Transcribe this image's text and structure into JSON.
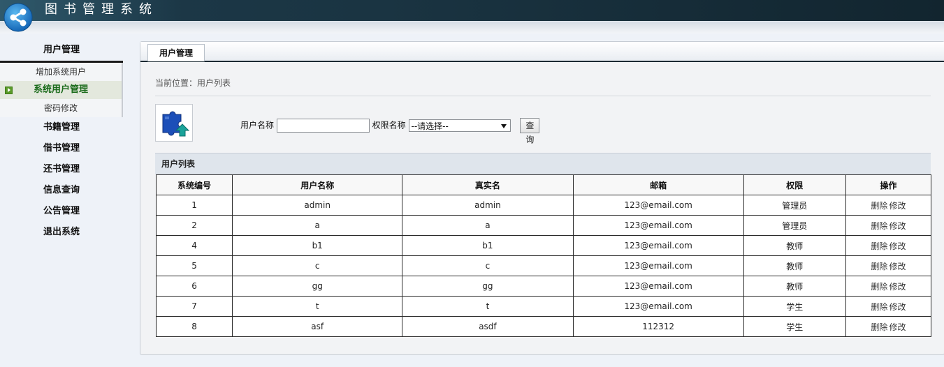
{
  "app": {
    "title": "图书管理系统"
  },
  "sidebar": {
    "open_menu": {
      "label": "用户管理",
      "items": [
        {
          "label": "增加系统用户",
          "active": false
        },
        {
          "label": "系统用户管理",
          "active": true
        },
        {
          "label": "密码修改",
          "active": false
        }
      ]
    },
    "menus": [
      "书籍管理",
      "借书管理",
      "还书管理",
      "信息查询",
      "公告管理",
      "退出系统"
    ]
  },
  "tab": {
    "label": "用户管理"
  },
  "breadcrumb": "当前位置：用户列表",
  "search": {
    "username_label": "用户名称",
    "username_value": "",
    "role_label": "权限名称",
    "role_selected": "--请选择--",
    "query_label": "查询"
  },
  "list": {
    "title": "用户列表",
    "columns": [
      "系统编号",
      "用户名称",
      "真实名",
      "邮箱",
      "权限",
      "操作"
    ],
    "rows": [
      {
        "id": "1",
        "username": "admin",
        "realname": "admin",
        "email": "123@email.com",
        "role": "管理员"
      },
      {
        "id": "2",
        "username": "a",
        "realname": "a",
        "email": "123@email.com",
        "role": "管理员"
      },
      {
        "id": "4",
        "username": "b1",
        "realname": "b1",
        "email": "123@email.com",
        "role": "教师"
      },
      {
        "id": "5",
        "username": "c",
        "realname": "c",
        "email": "123@email.com",
        "role": "教师"
      },
      {
        "id": "6",
        "username": "gg",
        "realname": "gg",
        "email": "123@email.com",
        "role": "教师"
      },
      {
        "id": "7",
        "username": "t",
        "realname": "t",
        "email": "123@email.com",
        "role": "学生"
      },
      {
        "id": "8",
        "username": "asf",
        "realname": "asdf",
        "email": "112312",
        "role": "学生"
      }
    ],
    "actions": {
      "delete": "删除",
      "edit": "修改"
    }
  },
  "colors": {
    "header_band": "#1d3a4a",
    "active_green": "#1b6b1b",
    "logo_blue": "#1e7fd0"
  },
  "icons": {
    "logo": "share-network-icon",
    "user_icon": "puzzle-upload-icon",
    "active_marker": "arrow-right-icon"
  }
}
